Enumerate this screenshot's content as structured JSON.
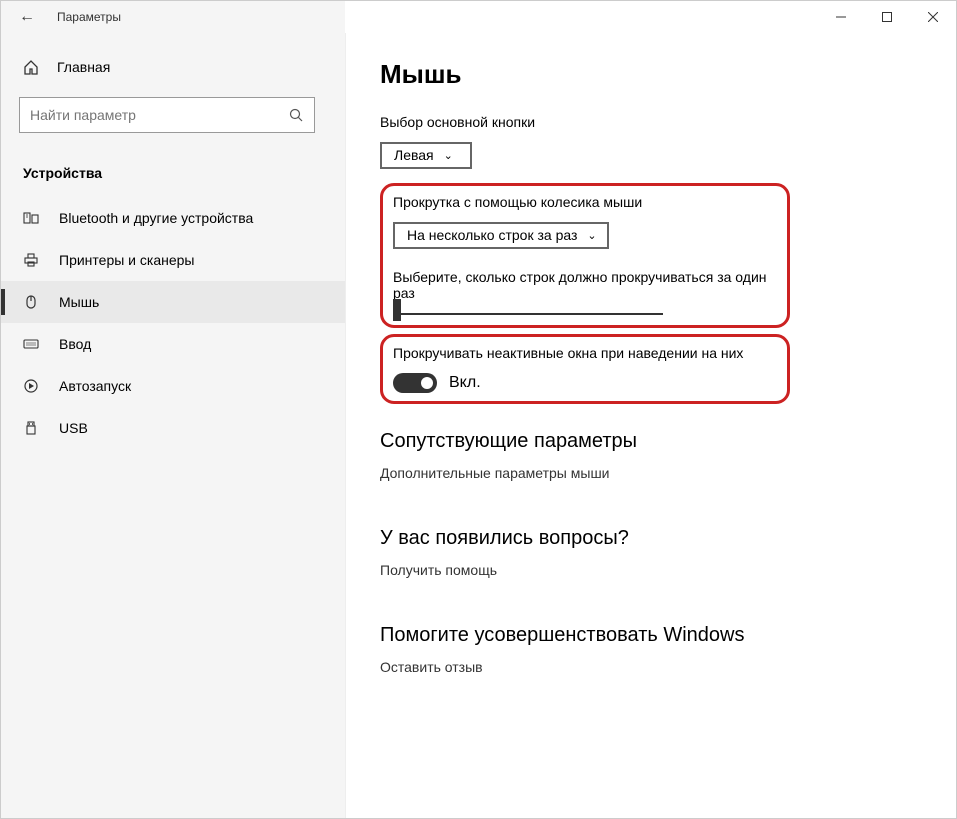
{
  "window": {
    "title": "Параметры"
  },
  "sidebar": {
    "home": "Главная",
    "search_placeholder": "Найти параметр",
    "category": "Устройства",
    "items": [
      "Bluetooth и другие устройства",
      "Принтеры и сканеры",
      "Мышь",
      "Ввод",
      "Автозапуск",
      "USB"
    ]
  },
  "main": {
    "title": "Мышь",
    "primary_button_label": "Выбор основной кнопки",
    "primary_button_value": "Левая",
    "scroll_wheel_label": "Прокрутка с помощью колесика мыши",
    "scroll_wheel_value": "На несколько строк за раз",
    "lines_label": "Выберите, сколько строк должно прокручиваться за один раз",
    "inactive_scroll_label": "Прокручивать неактивные окна при наведении на них",
    "toggle_state": "Вкл.",
    "related_header": "Сопутствующие параметры",
    "related_link": "Дополнительные параметры мыши",
    "questions_header": "У вас появились вопросы?",
    "questions_link": "Получить помощь",
    "improve_header": "Помогите усовершенствовать Windows",
    "improve_link": "Оставить отзыв"
  }
}
